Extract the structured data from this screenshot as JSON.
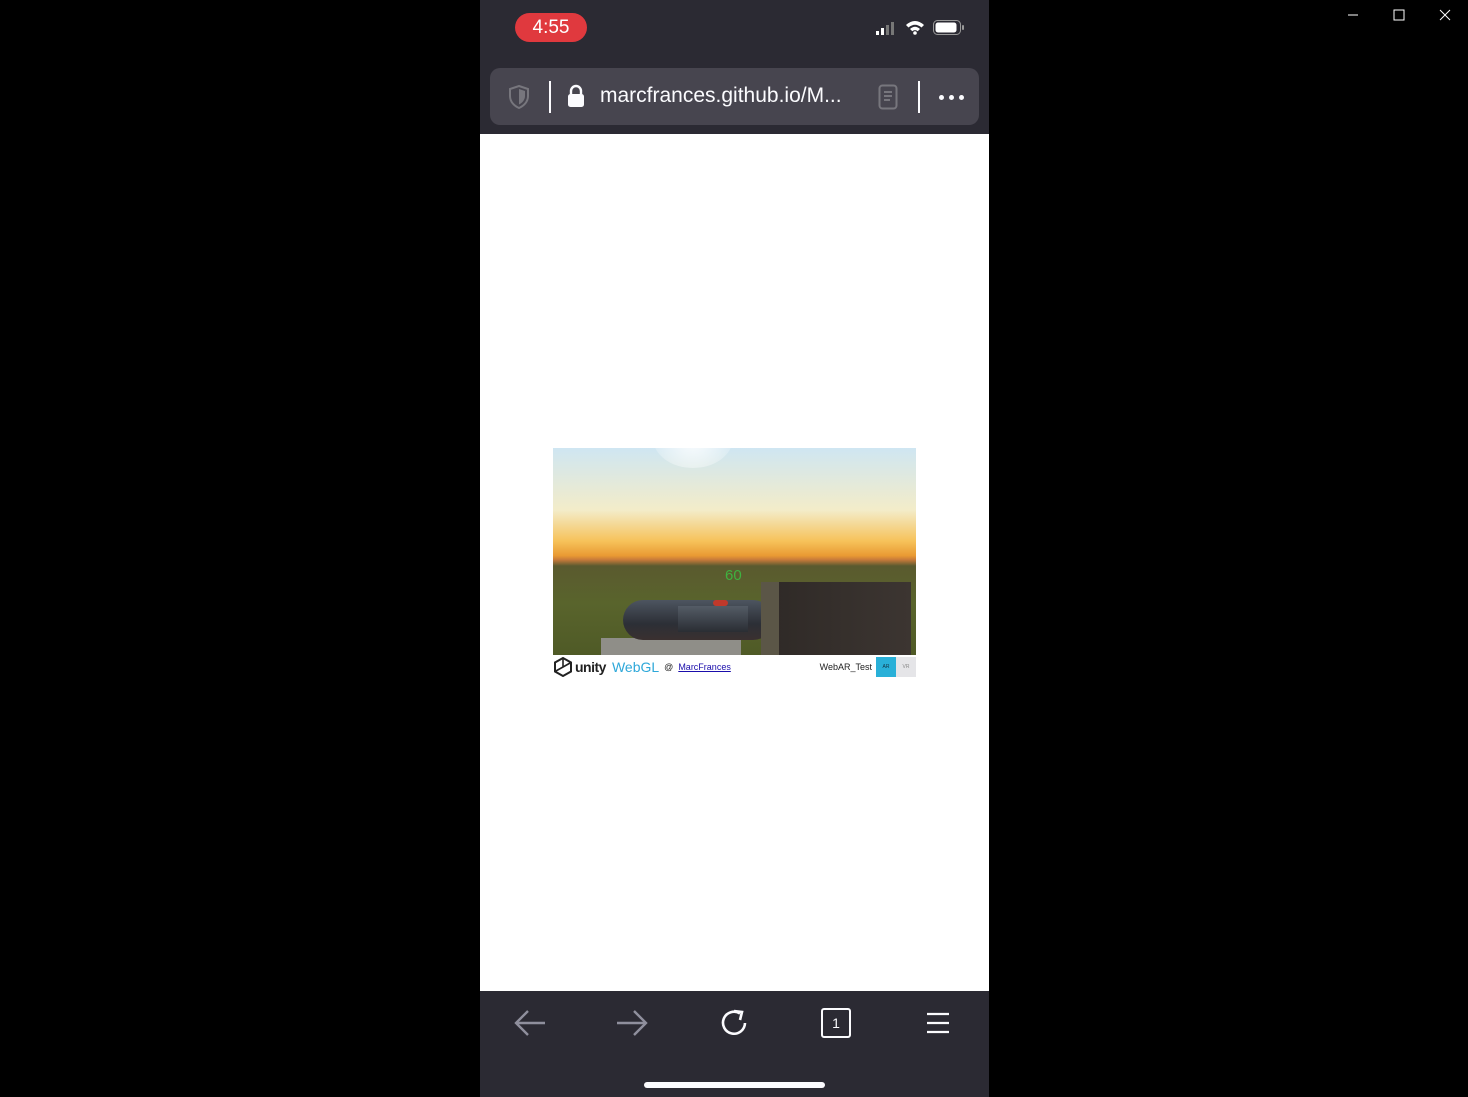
{
  "window": {
    "controls": [
      "minimize",
      "maximize",
      "close"
    ]
  },
  "status_bar": {
    "time": "4:55",
    "icons": [
      "cellular-signal-icon",
      "wifi-icon",
      "battery-icon"
    ]
  },
  "url_bar": {
    "url": "marcfrances.github.io/M...",
    "icons": [
      "tracking-shield-icon",
      "lock-icon",
      "reader-mode-icon",
      "more-options-icon"
    ]
  },
  "game": {
    "fps": "60",
    "footer": {
      "engine": "unity",
      "platform": "WebGL",
      "at": "@",
      "author": "MarcFrances",
      "title": "WebAR_Test",
      "ar_label": "AR",
      "vr_label": "VR"
    }
  },
  "toolbar": {
    "tab_count": "1",
    "icons": [
      "back-arrow-icon",
      "forward-arrow-icon",
      "reload-icon",
      "tabs-icon",
      "menu-icon"
    ]
  },
  "colors": {
    "chrome_bg": "#2b2a33",
    "url_field_bg": "#47454f",
    "recording_pill": "#e0393e",
    "fps_text": "#3fb23f",
    "webgl_blue": "#2ea8d9",
    "ar_button": "#29b0d8"
  }
}
